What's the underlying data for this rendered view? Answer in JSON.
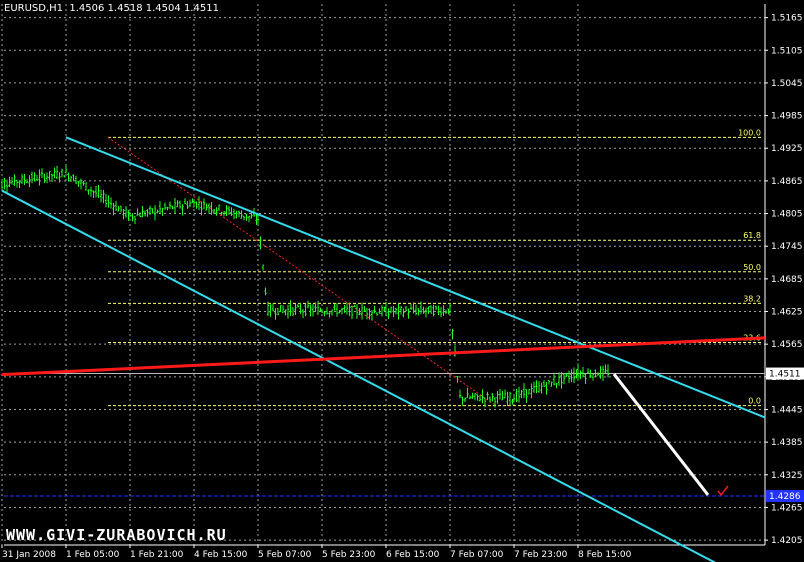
{
  "header": {
    "symbol": "EURUSD,H1",
    "open": "1.4506",
    "high": "1.4518",
    "low": "1.4504",
    "close": "1.4511"
  },
  "watermark": "WWW.GIVI-ZURABOVICH.RU",
  "colors": {
    "background": "#000000",
    "grid": "#9aa3a3",
    "axis": "#ffffff",
    "candles": "#22ff22",
    "channel": "#33ddee",
    "fib": "#ffff66",
    "fib_diagonal": "#ff2222",
    "red_line": "#ff1a1a",
    "projection": "#ffffff",
    "blue_level": "#2233ff",
    "current_price_label": "#ffffff",
    "blue_price_label": "#2233ff"
  },
  "chart_data": {
    "type": "line",
    "symbol": "EURUSD",
    "timeframe": "H1",
    "title": "EURUSD,H1",
    "xlabel": "",
    "ylabel": "",
    "x_ticks": [
      "31 Jan 2008",
      "1 Feb 05:00",
      "1 Feb 21:00",
      "4 Feb 15:00",
      "5 Feb 07:00",
      "5 Feb 23:00",
      "6 Feb 15:00",
      "7 Feb 07:00",
      "7 Feb 23:00",
      "8 Feb 15:00"
    ],
    "y_ticks": [
      "1.5165",
      "1.5105",
      "1.5045",
      "1.4985",
      "1.4925",
      "1.4865",
      "1.4805",
      "1.4745",
      "1.4685",
      "1.4625",
      "1.4565",
      "1.4505",
      "1.4445",
      "1.4385",
      "1.4325",
      "1.4265",
      "1.4205"
    ],
    "ylim": [
      1.4196,
      1.519
    ],
    "grid": true,
    "current_price": "1.4511",
    "blue_level_price": "1.4286",
    "series": [
      {
        "x": [
          "31 Jan 2008",
          "1 Feb 05:00",
          "1 Feb 21:00",
          "4 Feb 15:00",
          "5 Feb 07:00",
          "5 Feb 23:00",
          "6 Feb 15:00",
          "7 Feb 07:00",
          "7 Feb 23:00",
          "8 Feb 15:00"
        ],
        "values": [
          1.486,
          1.488,
          1.48,
          1.4825,
          1.4795,
          1.4628,
          1.4625,
          1.4628,
          1.4467,
          1.4512
        ]
      }
    ],
    "fibonacci": [
      {
        "label": "100.0",
        "price": 1.4945
      },
      {
        "label": "61.8",
        "price": 1.4756
      },
      {
        "label": "50.0",
        "price": 1.4698
      },
      {
        "label": "38.2",
        "price": 1.464
      },
      {
        "label": "23.6",
        "price": 1.4568
      },
      {
        "label": "0.0",
        "price": 1.4452
      }
    ],
    "channel_upper": {
      "x": [
        "1 Feb 05:00",
        "8 Feb 15:00"
      ],
      "y": [
        1.4945,
        1.4568
      ]
    },
    "channel_lower": {
      "x": [
        "31 Jan 2008",
        "8 Feb 15:00"
      ],
      "y": [
        1.4847,
        1.4295
      ]
    },
    "red_trendline": {
      "x": [
        "31 Jan 2008",
        "8 Feb 15:00"
      ],
      "y": [
        1.4509,
        1.456
      ]
    },
    "projection": {
      "from": 1.451,
      "to": 1.4288
    }
  }
}
